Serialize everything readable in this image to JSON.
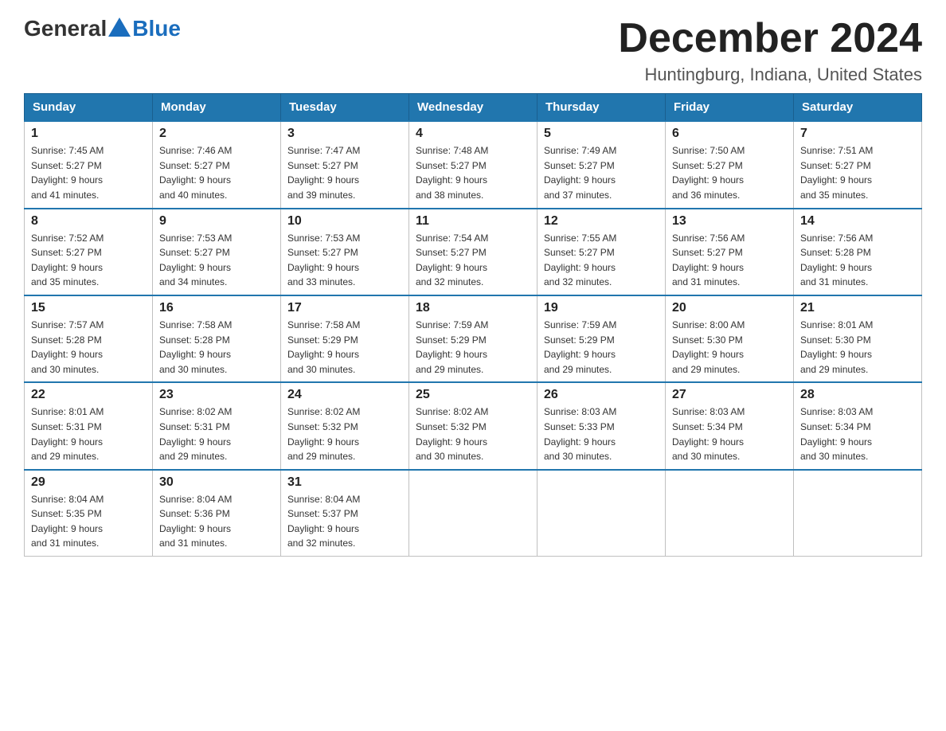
{
  "logo": {
    "text_general": "General",
    "text_blue": "Blue"
  },
  "title": "December 2024",
  "subtitle": "Huntingburg, Indiana, United States",
  "days_of_week": [
    "Sunday",
    "Monday",
    "Tuesday",
    "Wednesday",
    "Thursday",
    "Friday",
    "Saturday"
  ],
  "weeks": [
    [
      {
        "day": "1",
        "sunrise": "7:45 AM",
        "sunset": "5:27 PM",
        "daylight": "9 hours and 41 minutes."
      },
      {
        "day": "2",
        "sunrise": "7:46 AM",
        "sunset": "5:27 PM",
        "daylight": "9 hours and 40 minutes."
      },
      {
        "day": "3",
        "sunrise": "7:47 AM",
        "sunset": "5:27 PM",
        "daylight": "9 hours and 39 minutes."
      },
      {
        "day": "4",
        "sunrise": "7:48 AM",
        "sunset": "5:27 PM",
        "daylight": "9 hours and 38 minutes."
      },
      {
        "day": "5",
        "sunrise": "7:49 AM",
        "sunset": "5:27 PM",
        "daylight": "9 hours and 37 minutes."
      },
      {
        "day": "6",
        "sunrise": "7:50 AM",
        "sunset": "5:27 PM",
        "daylight": "9 hours and 36 minutes."
      },
      {
        "day": "7",
        "sunrise": "7:51 AM",
        "sunset": "5:27 PM",
        "daylight": "9 hours and 35 minutes."
      }
    ],
    [
      {
        "day": "8",
        "sunrise": "7:52 AM",
        "sunset": "5:27 PM",
        "daylight": "9 hours and 35 minutes."
      },
      {
        "day": "9",
        "sunrise": "7:53 AM",
        "sunset": "5:27 PM",
        "daylight": "9 hours and 34 minutes."
      },
      {
        "day": "10",
        "sunrise": "7:53 AM",
        "sunset": "5:27 PM",
        "daylight": "9 hours and 33 minutes."
      },
      {
        "day": "11",
        "sunrise": "7:54 AM",
        "sunset": "5:27 PM",
        "daylight": "9 hours and 32 minutes."
      },
      {
        "day": "12",
        "sunrise": "7:55 AM",
        "sunset": "5:27 PM",
        "daylight": "9 hours and 32 minutes."
      },
      {
        "day": "13",
        "sunrise": "7:56 AM",
        "sunset": "5:27 PM",
        "daylight": "9 hours and 31 minutes."
      },
      {
        "day": "14",
        "sunrise": "7:56 AM",
        "sunset": "5:28 PM",
        "daylight": "9 hours and 31 minutes."
      }
    ],
    [
      {
        "day": "15",
        "sunrise": "7:57 AM",
        "sunset": "5:28 PM",
        "daylight": "9 hours and 30 minutes."
      },
      {
        "day": "16",
        "sunrise": "7:58 AM",
        "sunset": "5:28 PM",
        "daylight": "9 hours and 30 minutes."
      },
      {
        "day": "17",
        "sunrise": "7:58 AM",
        "sunset": "5:29 PM",
        "daylight": "9 hours and 30 minutes."
      },
      {
        "day": "18",
        "sunrise": "7:59 AM",
        "sunset": "5:29 PM",
        "daylight": "9 hours and 29 minutes."
      },
      {
        "day": "19",
        "sunrise": "7:59 AM",
        "sunset": "5:29 PM",
        "daylight": "9 hours and 29 minutes."
      },
      {
        "day": "20",
        "sunrise": "8:00 AM",
        "sunset": "5:30 PM",
        "daylight": "9 hours and 29 minutes."
      },
      {
        "day": "21",
        "sunrise": "8:01 AM",
        "sunset": "5:30 PM",
        "daylight": "9 hours and 29 minutes."
      }
    ],
    [
      {
        "day": "22",
        "sunrise": "8:01 AM",
        "sunset": "5:31 PM",
        "daylight": "9 hours and 29 minutes."
      },
      {
        "day": "23",
        "sunrise": "8:02 AM",
        "sunset": "5:31 PM",
        "daylight": "9 hours and 29 minutes."
      },
      {
        "day": "24",
        "sunrise": "8:02 AM",
        "sunset": "5:32 PM",
        "daylight": "9 hours and 29 minutes."
      },
      {
        "day": "25",
        "sunrise": "8:02 AM",
        "sunset": "5:32 PM",
        "daylight": "9 hours and 30 minutes."
      },
      {
        "day": "26",
        "sunrise": "8:03 AM",
        "sunset": "5:33 PM",
        "daylight": "9 hours and 30 minutes."
      },
      {
        "day": "27",
        "sunrise": "8:03 AM",
        "sunset": "5:34 PM",
        "daylight": "9 hours and 30 minutes."
      },
      {
        "day": "28",
        "sunrise": "8:03 AM",
        "sunset": "5:34 PM",
        "daylight": "9 hours and 30 minutes."
      }
    ],
    [
      {
        "day": "29",
        "sunrise": "8:04 AM",
        "sunset": "5:35 PM",
        "daylight": "9 hours and 31 minutes."
      },
      {
        "day": "30",
        "sunrise": "8:04 AM",
        "sunset": "5:36 PM",
        "daylight": "9 hours and 31 minutes."
      },
      {
        "day": "31",
        "sunrise": "8:04 AM",
        "sunset": "5:37 PM",
        "daylight": "9 hours and 32 minutes."
      },
      null,
      null,
      null,
      null
    ]
  ],
  "labels": {
    "sunrise_prefix": "Sunrise: ",
    "sunset_prefix": "Sunset: ",
    "daylight_prefix": "Daylight: "
  }
}
